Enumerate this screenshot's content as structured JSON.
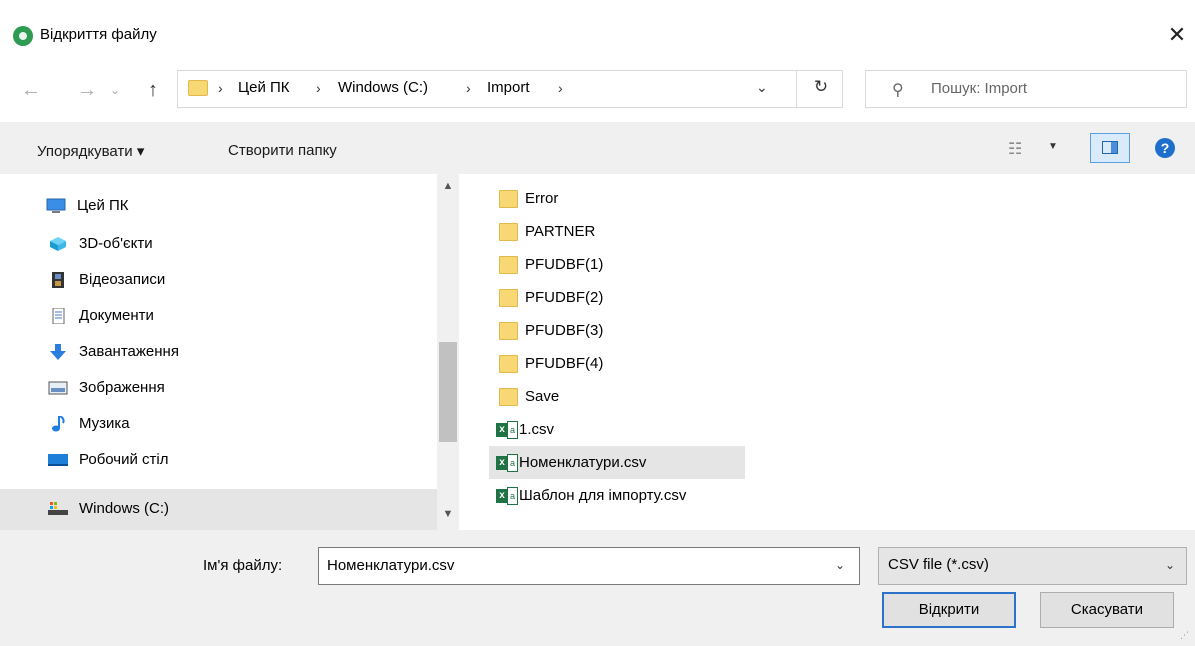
{
  "window": {
    "title": "Відкриття файлу",
    "close_glyph": "✕"
  },
  "nav": {
    "back_glyph": "←",
    "forward_glyph": "→",
    "recent_glyph": "⌄",
    "up_glyph": "↑",
    "breadcrumb": [
      "Цей ПК",
      "Windows (C:)",
      "Import"
    ],
    "separator": "›",
    "dropdown_glyph": "⌄",
    "refresh_glyph": "↻",
    "search_placeholder": "Пошук: Import",
    "search_glyph": "⚲"
  },
  "toolbar": {
    "organize_label": "Упорядкувати ▾",
    "new_folder_label": "Створити папку",
    "view_glyph": "☷",
    "view_caret": "▼",
    "help_glyph": "?"
  },
  "sidebar": {
    "items": [
      {
        "label": "Цей ПК",
        "icon": "computer-icon"
      },
      {
        "label": "3D-об'єкти",
        "icon": "cube-3d-icon"
      },
      {
        "label": "Відеозаписи",
        "icon": "film-icon"
      },
      {
        "label": "Документи",
        "icon": "document-icon"
      },
      {
        "label": "Завантаження",
        "icon": "download-arrow-icon"
      },
      {
        "label": "Зображення",
        "icon": "picture-icon"
      },
      {
        "label": "Музика",
        "icon": "music-note-icon"
      },
      {
        "label": "Робочий стіл",
        "icon": "desktop-icon"
      },
      {
        "label": "Windows (C:)",
        "icon": "drive-icon"
      }
    ],
    "scroll_up": "▲",
    "scroll_down": "▼"
  },
  "files": {
    "items": [
      {
        "name": "Error",
        "type": "folder"
      },
      {
        "name": "PARTNER",
        "type": "folder"
      },
      {
        "name": "PFUDBF(1)",
        "type": "folder"
      },
      {
        "name": "PFUDBF(2)",
        "type": "folder"
      },
      {
        "name": "PFUDBF(3)",
        "type": "folder"
      },
      {
        "name": "PFUDBF(4)",
        "type": "folder"
      },
      {
        "name": "Save",
        "type": "folder"
      },
      {
        "name": "1.csv",
        "type": "csv"
      },
      {
        "name": "Номенклатури.csv",
        "type": "csv"
      },
      {
        "name": "Шаблон для імпорту.csv",
        "type": "csv"
      }
    ]
  },
  "footer": {
    "filename_label": "Ім'я файлу:",
    "filename_value": "Номенклатури.csv",
    "filetype_value": "CSV file (*.csv)",
    "open_label": "Відкрити",
    "cancel_label": "Скасувати",
    "caret": "⌄"
  },
  "colors": {
    "accent": "#2a73c9",
    "toolbar_bg": "#f0f0f0",
    "selection_bg": "#e5e5e5",
    "folder": "#f8d775",
    "excel": "#1f7244"
  }
}
